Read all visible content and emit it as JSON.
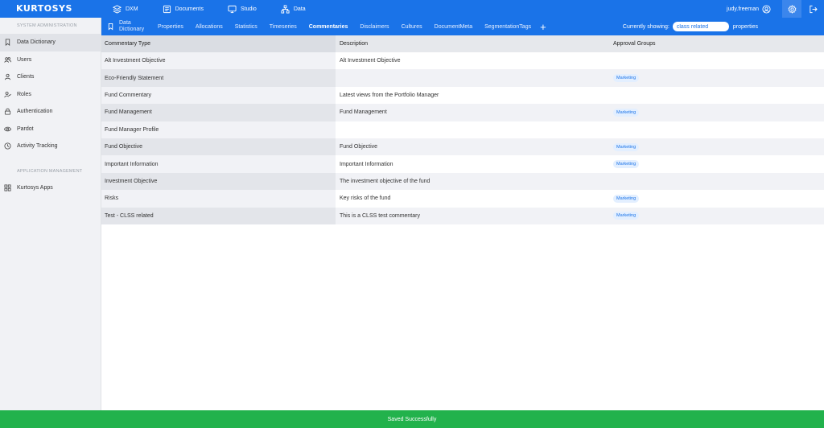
{
  "app": {
    "logo": "KURTOSYS"
  },
  "topnav": [
    {
      "label": "DXM",
      "icon": "layers-icon"
    },
    {
      "label": "Documents",
      "icon": "documents-icon"
    },
    {
      "label": "Studio",
      "icon": "monitor-icon"
    },
    {
      "label": "Data",
      "icon": "hierarchy-icon"
    }
  ],
  "user": {
    "name": "judy.freeman"
  },
  "sidebar": {
    "section1": "SYSTEM ADMINISTRATION",
    "items": [
      {
        "label": "Data Dictionary",
        "icon": "bookmark-icon"
      },
      {
        "label": "Users",
        "icon": "users-icon"
      },
      {
        "label": "Clients",
        "icon": "person-icon"
      },
      {
        "label": "Roles",
        "icon": "role-icon"
      },
      {
        "label": "Authentication",
        "icon": "lock-icon"
      },
      {
        "label": "Pardot",
        "icon": "eye-icon"
      },
      {
        "label": "Activity Tracking",
        "icon": "clock-icon"
      }
    ],
    "section2": "APPLICATION MANAGEMENT",
    "items2": [
      {
        "label": "Kurtosys Apps",
        "icon": "grid-icon"
      }
    ]
  },
  "tabs": [
    {
      "label": "Data Dictionary"
    },
    {
      "label": "Properties"
    },
    {
      "label": "Allocations"
    },
    {
      "label": "Statistics"
    },
    {
      "label": "Timeseries"
    },
    {
      "label": "Commentaries"
    },
    {
      "label": "Disclaimers"
    },
    {
      "label": "Cultures"
    },
    {
      "label": "DocumentMeta"
    },
    {
      "label": "SegmentationTags"
    }
  ],
  "showing": {
    "label": "Currently showing:",
    "value": "class related",
    "suffix": "properties"
  },
  "table": {
    "headers": [
      "Commentary Type",
      "Description",
      "Approval Groups"
    ],
    "rows": [
      {
        "type": "Alt Investment Objective",
        "description": "Alt Investment Objective",
        "group": ""
      },
      {
        "type": "Eco-Friendly Statement",
        "description": "",
        "group": "Marketing"
      },
      {
        "type": "Fund Commentary",
        "description": "Latest views from the Portfolio Manager",
        "group": ""
      },
      {
        "type": "Fund Management",
        "description": "Fund Management",
        "group": "Marketing"
      },
      {
        "type": "Fund Manager Profile",
        "description": "",
        "group": ""
      },
      {
        "type": "Fund Objective",
        "description": "Fund Objective",
        "group": "Marketing"
      },
      {
        "type": "Important Information",
        "description": "Important Information",
        "group": "Marketing"
      },
      {
        "type": "Investment Objective",
        "description": "The investment objective of the fund",
        "group": ""
      },
      {
        "type": "Risks",
        "description": "Key risks of the fund",
        "group": "Marketing"
      },
      {
        "type": "Test - CLSS related",
        "description": "This is a CLSS test commentary",
        "group": "Marketing"
      }
    ]
  },
  "footer": {
    "message": "Saved Successfully"
  }
}
